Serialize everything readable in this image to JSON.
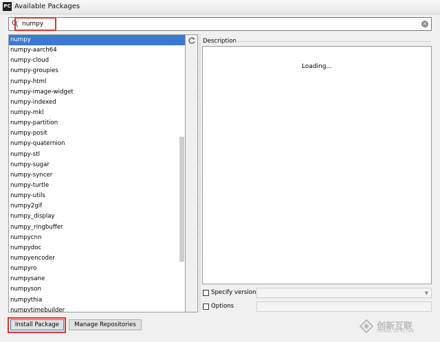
{
  "window": {
    "title": "Available Packages",
    "icon_text": "PC"
  },
  "search": {
    "value": "numpy",
    "placeholder": ""
  },
  "packages": [
    "numpy",
    "numpy-aarch64",
    "numpy-cloud",
    "numpy-groupies",
    "numpy-html",
    "numpy-image-widget",
    "numpy-indexed",
    "numpy-mkl",
    "numpy-partition",
    "numpy-posit",
    "numpy-quaternion",
    "numpy-stl",
    "numpy-sugar",
    "numpy-syncer",
    "numpy-turtle",
    "numpy-utils",
    "numpy2gif",
    "numpy_display",
    "numpy_ringbuffer",
    "numpycnn",
    "numpydoc",
    "numpyencoder",
    "numpyro",
    "numpysane",
    "numpyson",
    "numpythia",
    "numpytimebuilder"
  ],
  "selected_index": 0,
  "description": {
    "label": "Description",
    "loading_text": "Loading..."
  },
  "options": {
    "specify_version_label": "Specify version",
    "options_label": "Options",
    "specify_version_checked": false,
    "options_checked": false
  },
  "buttons": {
    "install_label": "Install Package",
    "manage_label": "Manage Repositories"
  },
  "watermark": {
    "text": "创新互联",
    "subtext": "CHUANG XIN HU LIAN"
  },
  "colors": {
    "selection": "#3c78d8",
    "highlight_box": "#e03131"
  }
}
